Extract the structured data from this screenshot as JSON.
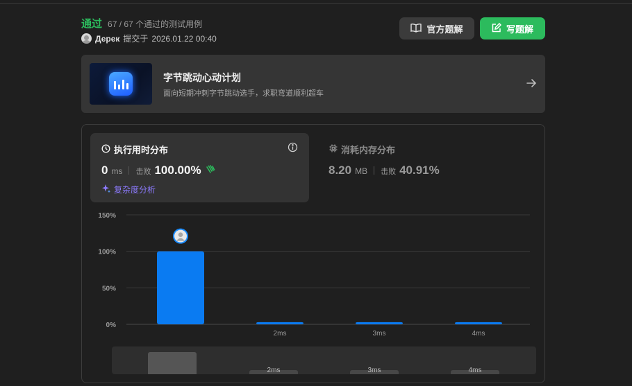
{
  "status": {
    "label": "通过",
    "count": "67 / 67",
    "count_suffix": "个通过的测试用例"
  },
  "submitter": {
    "name": "Дерек",
    "submitted_prefix": "提交于",
    "time": "2026.01.22 00:40"
  },
  "actions": {
    "official_solution": "官方题解",
    "write_solution": "写题解"
  },
  "banner": {
    "title": "字节跳动心动计划",
    "description": "面向短期冲刺字节跳动选手，求职弯道顺利超车"
  },
  "runtime": {
    "title": "执行用时分布",
    "value": "0",
    "unit": "ms",
    "beats_label": "击败",
    "beats": "100.00%",
    "complexity": "复杂度分析"
  },
  "memory": {
    "title": "消耗内存分布",
    "value": "8.20",
    "unit": "MB",
    "beats_label": "击败",
    "beats": "40.91%"
  },
  "colors": {
    "accent_green": "#2cbb5d",
    "bar_blue": "#0a7bf2",
    "complexity_purple": "#8d7bff"
  },
  "chart_data": {
    "type": "bar",
    "categories": [
      "",
      "2ms",
      "3ms",
      "4ms"
    ],
    "values": [
      100,
      3,
      3,
      3
    ],
    "yticks": [
      "0%",
      "50%",
      "100%",
      "150%"
    ],
    "ylim": [
      0,
      150
    ],
    "grid": true,
    "highlight_index": 0
  },
  "overview": {
    "labels": [
      "2ms",
      "3ms",
      "4ms"
    ]
  }
}
